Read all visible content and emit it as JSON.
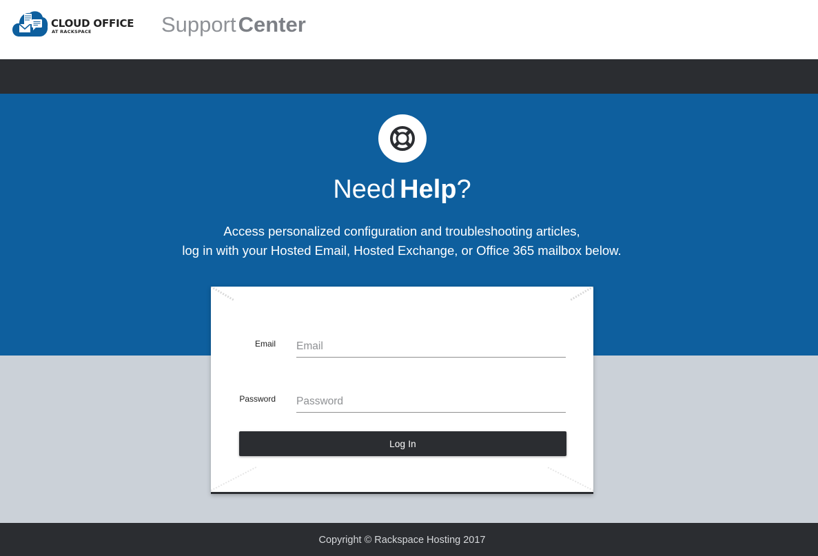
{
  "header": {
    "logo_line1": "CLOUD OFFICE",
    "logo_line2": "AT RACKSPACE",
    "logo_icon": "cloud-mail-icon",
    "brand_word1": "Support",
    "brand_word2": "Center"
  },
  "hero": {
    "icon": "lifebuoy-icon",
    "title_part1": "Need",
    "title_part2": "Help",
    "title_part3": "?",
    "description_line1": "Access personalized configuration and troubleshooting articles,",
    "description_line2": "log in with your Hosted Email, Hosted Exchange, or Office 365 mailbox below."
  },
  "login_form": {
    "email_label": "Email",
    "email_placeholder": "Email",
    "email_value": "",
    "password_label": "Password",
    "password_placeholder": "Password",
    "password_value": "",
    "submit_label": "Log In"
  },
  "footer": {
    "copyright": "Copyright © Rackspace Hosting 2017"
  },
  "colors": {
    "navbar": "#2b2d31",
    "hero_blue": "#0e5f9e",
    "gray_band": "#cbd1d8",
    "brand_text": "#8a8d92",
    "logo_blue": "#0e5f9e"
  }
}
